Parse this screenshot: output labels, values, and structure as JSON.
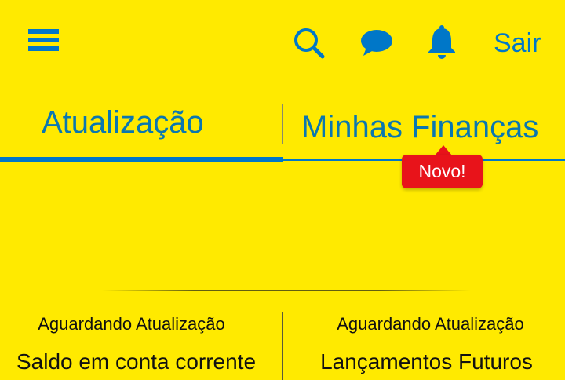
{
  "header": {
    "menu_icon": "hamburger-menu-icon",
    "search_icon": "search-icon",
    "chat_icon": "chat-bubble-icon",
    "notifications_icon": "bell-icon",
    "logout_label": "Sair"
  },
  "tabs": [
    {
      "label": "Atualização",
      "selected": true
    },
    {
      "label": "Minhas Finanças",
      "selected": false
    }
  ],
  "badge": {
    "label": "Novo!"
  },
  "cards": [
    {
      "status": "Aguardando Atualização",
      "title": "Saldo em conta corrente"
    },
    {
      "status": "Aguardando Atualização",
      "title": "Lançamentos Futuros"
    }
  ],
  "colors": {
    "background": "#FFEA00",
    "accent": "#0077C8",
    "tab_text": "#0A77B0",
    "badge": "#E8131A",
    "text": "#111111"
  }
}
